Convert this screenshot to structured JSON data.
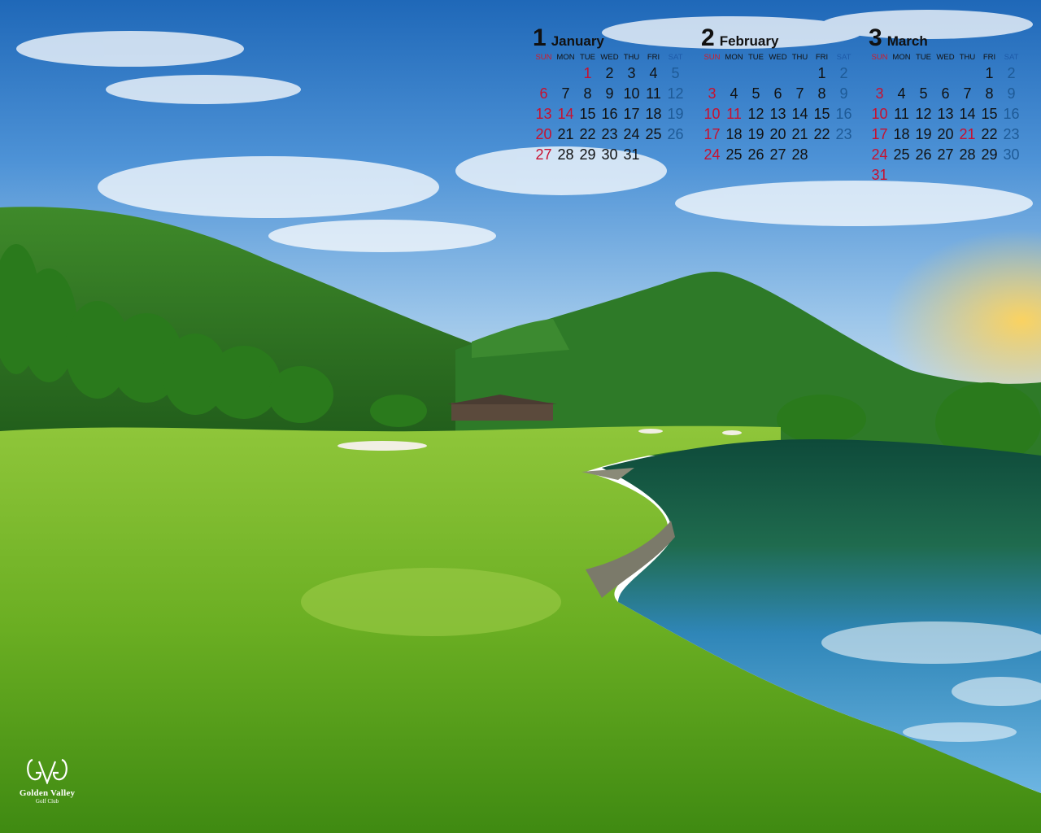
{
  "calendar": {
    "dow": [
      "SUN",
      "MON",
      "TUE",
      "WED",
      "THU",
      "FRI",
      "SAT"
    ],
    "colors": {
      "sunday": "#c8102e",
      "saturday": "#1e5a96",
      "weekday": "#111111"
    },
    "months": [
      {
        "number": "1",
        "name": "January",
        "weeks": [
          [
            "",
            "",
            "1",
            "2",
            "3",
            "4",
            "5"
          ],
          [
            "6",
            "7",
            "8",
            "9",
            "10",
            "11",
            "12"
          ],
          [
            "13",
            "14",
            "15",
            "16",
            "17",
            "18",
            "19"
          ],
          [
            "20",
            "21",
            "22",
            "23",
            "24",
            "25",
            "26"
          ],
          [
            "27",
            "28",
            "29",
            "30",
            "31",
            "",
            ""
          ]
        ],
        "holidays": [
          "1",
          "14"
        ]
      },
      {
        "number": "2",
        "name": "February",
        "weeks": [
          [
            "",
            "",
            "",
            "",
            "",
            "1",
            "2"
          ],
          [
            "3",
            "4",
            "5",
            "6",
            "7",
            "8",
            "9"
          ],
          [
            "10",
            "11",
            "12",
            "13",
            "14",
            "15",
            "16"
          ],
          [
            "17",
            "18",
            "19",
            "20",
            "21",
            "22",
            "23"
          ],
          [
            "24",
            "25",
            "26",
            "27",
            "28",
            "",
            ""
          ]
        ],
        "holidays": [
          "11"
        ]
      },
      {
        "number": "3",
        "name": "March",
        "weeks": [
          [
            "",
            "",
            "",
            "",
            "",
            "1",
            "2"
          ],
          [
            "3",
            "4",
            "5",
            "6",
            "7",
            "8",
            "9"
          ],
          [
            "10",
            "11",
            "12",
            "13",
            "14",
            "15",
            "16"
          ],
          [
            "17",
            "18",
            "19",
            "20",
            "21",
            "22",
            "23"
          ],
          [
            "24",
            "25",
            "26",
            "27",
            "28",
            "29",
            "30"
          ],
          [
            "31",
            "",
            "",
            "",
            "",
            "",
            ""
          ]
        ],
        "holidays": [
          "21"
        ]
      }
    ]
  },
  "logo": {
    "monogram": "GVG",
    "title": "Golden Valley",
    "subtitle": "Golf Club"
  }
}
